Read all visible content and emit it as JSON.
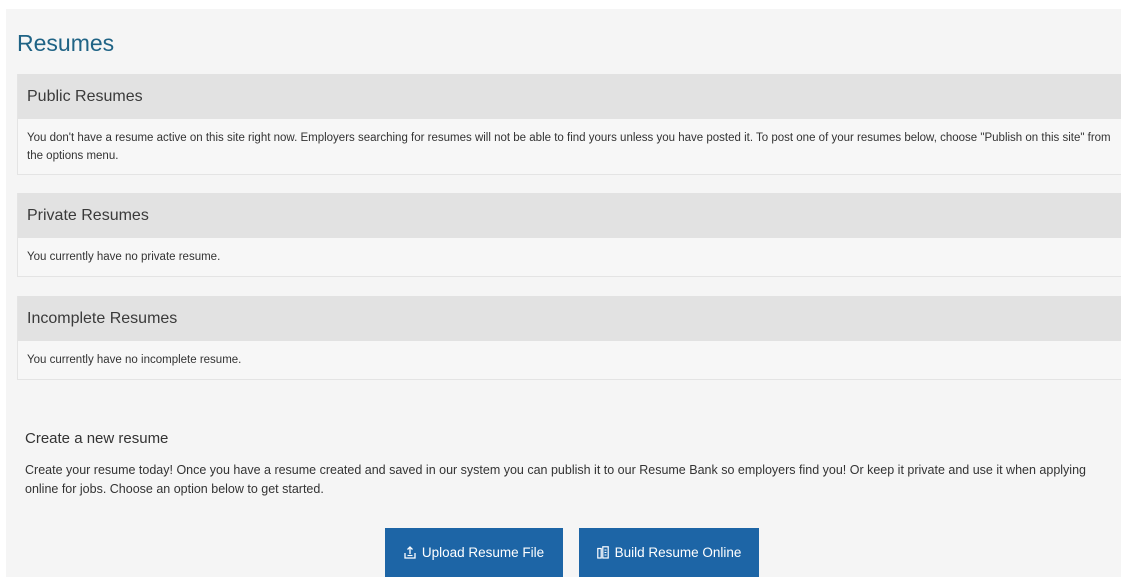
{
  "page": {
    "title": "Resumes"
  },
  "sections": {
    "public": {
      "heading": "Public Resumes",
      "message": "You don't have a resume active on this site right now. Employers searching for resumes will not be able to find yours unless you have posted it. To post one of your resumes below, choose \"Publish on this site\" from the options menu."
    },
    "private": {
      "heading": "Private Resumes",
      "message": "You currently have no private resume."
    },
    "incomplete": {
      "heading": "Incomplete Resumes",
      "message": "You currently have no incomplete resume."
    }
  },
  "create": {
    "title": "Create a new resume",
    "description": "Create your resume today! Once you have a resume created and saved in our system you can publish it to our Resume Bank so employers find you! Or keep it private and use it when applying online for jobs. Choose an option below to get started.",
    "upload_label": "Upload Resume File",
    "upload_icon": "upload-icon",
    "build_label": "Build Resume Online",
    "build_icon": "build-icon"
  },
  "colors": {
    "title": "#1f6385",
    "button": "#1d65a6",
    "section_header": "#e2e2e2"
  }
}
